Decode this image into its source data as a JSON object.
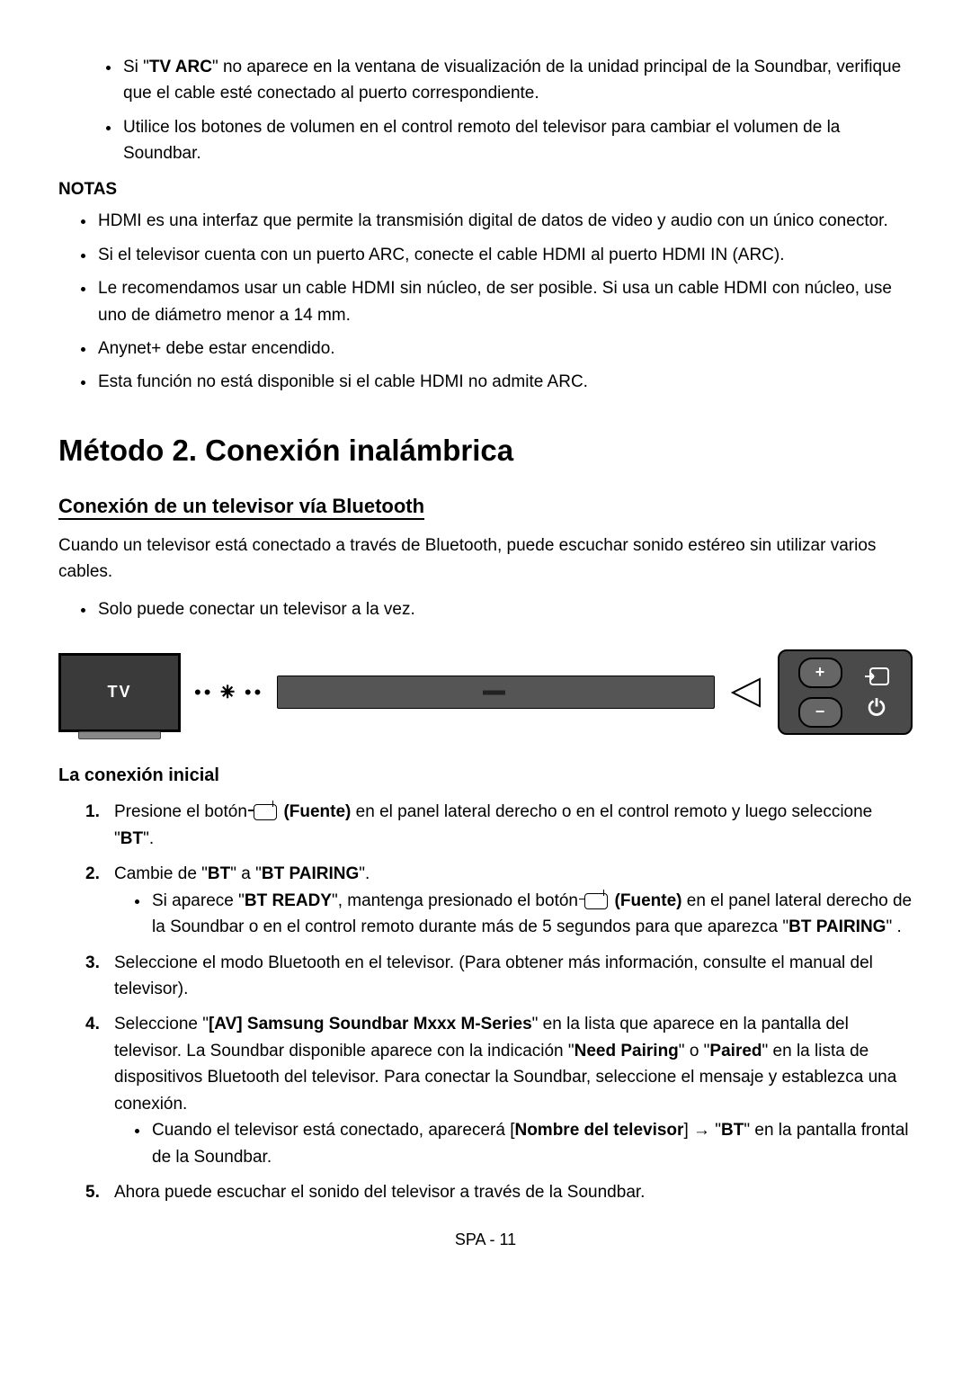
{
  "top_bullets": [
    {
      "pre": "Si \"",
      "bold": "TV ARC",
      "post": "\" no aparece en la ventana de visualización de la unidad principal de la Soundbar, verifique que el cable esté conectado al puerto correspondiente."
    },
    {
      "text": "Utilice los botones de volumen en el control remoto del televisor para cambiar el volumen de la Soundbar."
    }
  ],
  "notas_heading": "NOTAS",
  "notas_list": [
    "HDMI es una interfaz que permite la transmisión digital de datos de video y audio con un único conector.",
    "Si el televisor cuenta con un puerto ARC, conecte el cable HDMI al puerto HDMI IN (ARC).",
    "Le recomendamos usar un cable HDMI sin núcleo, de ser posible. Si usa un cable HDMI con núcleo, use uno de diámetro menor a 14 mm.",
    "Anynet+ debe estar encendido.",
    "Esta función no está disponible si el cable HDMI no admite ARC."
  ],
  "h1": "Método 2. Conexión inalámbrica",
  "h2": "Conexión de un televisor vía Bluetooth",
  "intro": "Cuando un televisor está conectado a través de Bluetooth, puede escuchar sonido estéreo sin utilizar varios cables.",
  "intro_bullet": "Solo puede conectar un televisor a la vez.",
  "figure": {
    "tv_label": "TV",
    "bt_signal": "•• ✱ ••",
    "indicator": "◀",
    "plus": "+",
    "minus": "−",
    "source": "⇦",
    "power": "⏻"
  },
  "h3": "La conexión inicial",
  "steps": {
    "1": {
      "pre": "Presione el botón ",
      "fuente": "(Fuente)",
      "post1": " en el panel lateral derecho o en el control remoto y luego seleccione \"",
      "bt": "BT",
      "post2": "\"."
    },
    "2": {
      "pre": "Cambie de \"",
      "bt1": "BT",
      "mid": "\" a \"",
      "bt2": "BT PAIRING",
      "post": "\"."
    },
    "2sub": {
      "pre": "Si aparece \"",
      "btready": "BT READY",
      "mid1": "\", mantenga presionado el botón ",
      "fuente": "(Fuente)",
      "mid2": " en el panel lateral derecho de la Soundbar o en el control remoto durante más de 5 segundos para que aparezca \"",
      "btpair": "BT PAIRING",
      "post": "\" ."
    },
    "3": "Seleccione el modo Bluetooth en el televisor. (Para obtener más información, consulte el manual del televisor).",
    "4": {
      "pre": "Seleccione \"",
      "av": "[AV] Samsung Soundbar Mxxx M-Series",
      "mid1": "\" en la lista que aparece en la pantalla del televisor. La Soundbar disponible aparece con la indicación \"",
      "np": "Need Pairing",
      "mid2": "\" o \"",
      "paired": "Paired",
      "post": "\" en la lista de dispositivos Bluetooth del televisor. Para conectar la Soundbar, seleccione el mensaje y establezca una conexión."
    },
    "4sub": {
      "pre": "Cuando el televisor está conectado, aparecerá [",
      "nombre": "Nombre del televisor",
      "mid": "] → \"",
      "bt": "BT",
      "post": "\" en la pantalla frontal de la Soundbar."
    },
    "5": "Ahora puede escuchar el sonido del televisor a través de la Soundbar."
  },
  "footer": "SPA - 11"
}
